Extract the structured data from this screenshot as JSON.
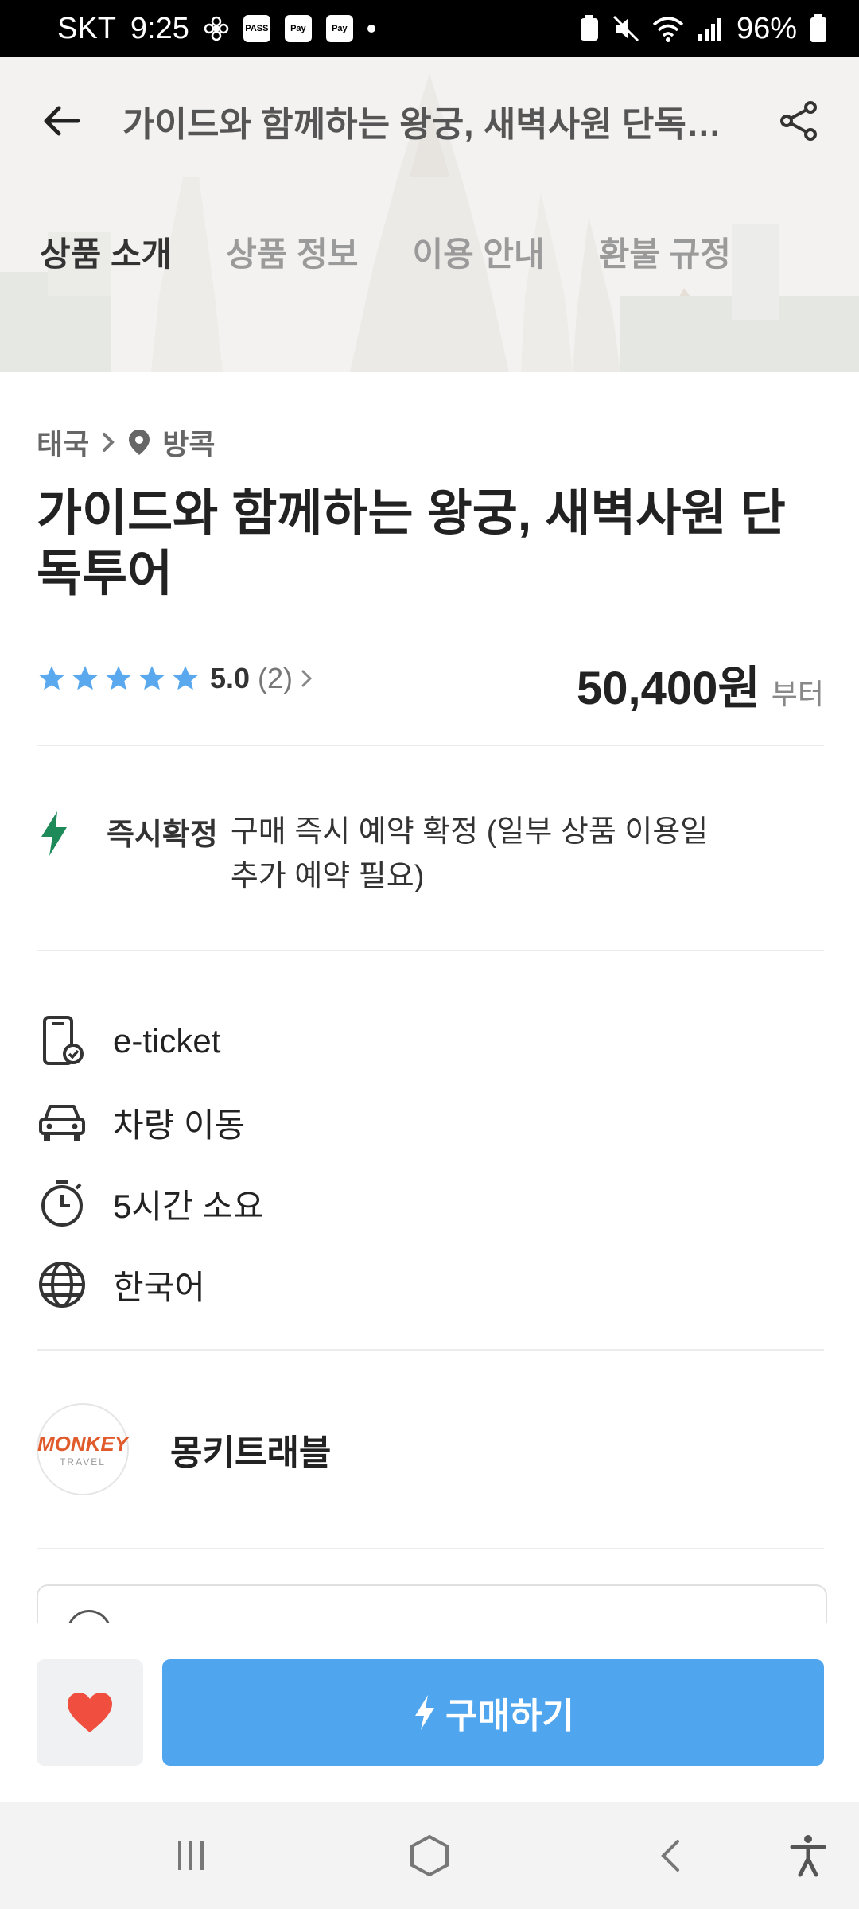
{
  "status_bar": {
    "carrier": "SKT",
    "time": "9:25",
    "notif_chips": [
      "PASS",
      "Pay",
      "Pay"
    ],
    "battery": "96%"
  },
  "header": {
    "title": "가이드와 함께하는 왕궁, 새벽사원 단독투어",
    "tabs": [
      {
        "label": "상품 소개",
        "active": true
      },
      {
        "label": "상품 정보",
        "active": false
      },
      {
        "label": "이용 안내",
        "active": false
      },
      {
        "label": "환불 규정",
        "active": false
      }
    ]
  },
  "product": {
    "breadcrumb": {
      "country": "태국",
      "city": "방콕"
    },
    "title": "가이드와 함께하는 왕궁, 새벽사원 단독투어",
    "rating": {
      "stars": 5,
      "score": "5.0",
      "count": "(2)"
    },
    "price": {
      "amount": "50,400원",
      "suffix": "부터"
    },
    "instant": {
      "label": "즉시확정",
      "description": "구매 즉시 예약 확정 (일부 상품 이용일 추가 예약 필요)"
    },
    "features": [
      {
        "icon": "mobile-ticket-icon",
        "label": "e-ticket"
      },
      {
        "icon": "car-icon",
        "label": "차량 이동"
      },
      {
        "icon": "timer-icon",
        "label": "5시간 소요"
      },
      {
        "icon": "globe-icon",
        "label": "한국어"
      }
    ],
    "seller": {
      "name": "몽키트래블",
      "logo_text": "MONKEY",
      "logo_subtext": "TRAVEL"
    }
  },
  "actions": {
    "buy_label": "구매하기",
    "wish_icon": "heart-icon"
  },
  "colors": {
    "accent": "#4fa6ee",
    "star": "#5aa9ef",
    "instant_bolt": "#1e8a5a",
    "heart": "#f04e3e"
  }
}
